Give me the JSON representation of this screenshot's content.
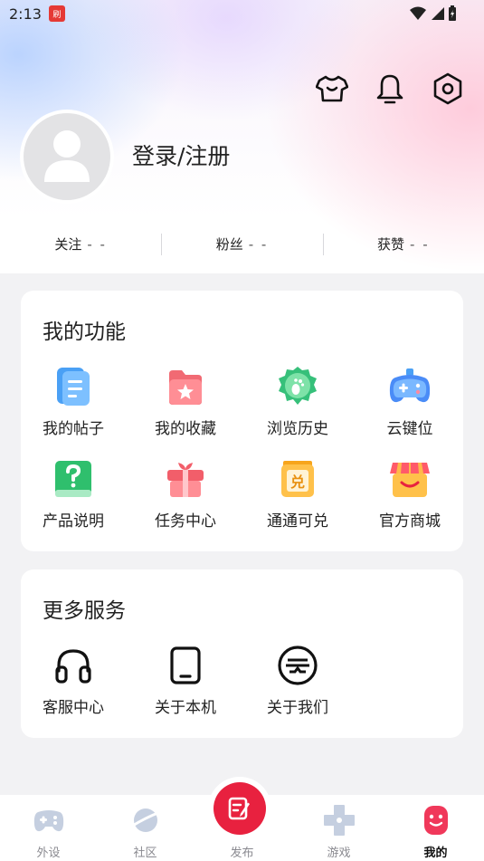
{
  "status_bar": {
    "time": "2:13",
    "app_badge": "刷"
  },
  "header": {
    "login_label": "登录/注册",
    "icons": [
      "shirt-icon",
      "bell-icon",
      "settings-icon"
    ]
  },
  "stats": [
    {
      "label": "关注",
      "value": "- -"
    },
    {
      "label": "粉丝",
      "value": "- -"
    },
    {
      "label": "获赞",
      "value": "- -"
    }
  ],
  "functions": {
    "title": "我的功能",
    "items": [
      {
        "label": "我的帖子",
        "icon": "posts-icon"
      },
      {
        "label": "我的收藏",
        "icon": "favorites-folder-icon"
      },
      {
        "label": "浏览历史",
        "icon": "history-footprint-icon"
      },
      {
        "label": "云键位",
        "icon": "gamepad-icon"
      },
      {
        "label": "产品说明",
        "icon": "help-book-icon"
      },
      {
        "label": "任务中心",
        "icon": "gift-icon"
      },
      {
        "label": "通通可兑",
        "icon": "exchange-icon"
      },
      {
        "label": "官方商城",
        "icon": "shop-icon"
      }
    ]
  },
  "services": {
    "title": "更多服务",
    "items": [
      {
        "label": "客服中心",
        "icon": "headset-icon"
      },
      {
        "label": "关于本机",
        "icon": "phone-icon"
      },
      {
        "label": "关于我们",
        "icon": "brand-logo-icon"
      }
    ]
  },
  "tabbar": {
    "tabs": [
      {
        "label": "外设",
        "icon": "gamepad-tab-icon"
      },
      {
        "label": "社区",
        "icon": "planet-icon"
      },
      {
        "label": "发布",
        "icon": "edit-icon"
      },
      {
        "label": "游戏",
        "icon": "dpad-icon"
      },
      {
        "label": "我的",
        "icon": "profile-icon"
      }
    ],
    "active": "我的"
  },
  "colors": {
    "accent": "#e8213f",
    "background": "#f2f2f4"
  }
}
